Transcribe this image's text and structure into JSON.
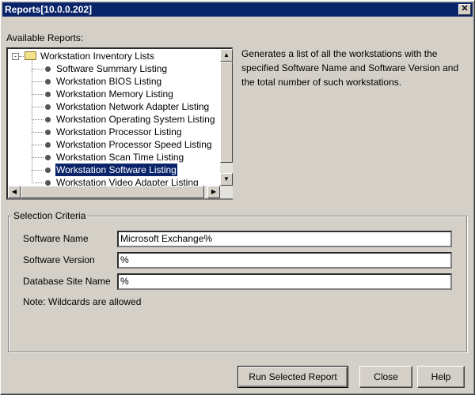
{
  "window": {
    "title": "Reports[10.0.0.202]",
    "close": "✕"
  },
  "available_reports_label": "Available Reports:",
  "tree": {
    "root": "Workstation Inventory Lists",
    "items": [
      "Software Summary Listing",
      "Workstation BIOS Listing",
      "Workstation Memory Listing",
      "Workstation Network Adapter Listing",
      "Workstation Operating System Listing",
      "Workstation Processor Listing",
      "Workstation Processor Speed Listing",
      "Workstation Scan Time Listing",
      "Workstation Software Listing",
      "Workstation Video Adapter Listing"
    ],
    "selected_index": 8
  },
  "description": "Generates a list of all the workstations with the specified Software Name and  Software Version and the total number of such workstations.",
  "criteria": {
    "title": "Selection Criteria",
    "fields": [
      {
        "label": "Software Name",
        "value": "Microsoft Exchange%"
      },
      {
        "label": "Software Version",
        "value": "%"
      },
      {
        "label": "Database Site Name",
        "value": "%"
      }
    ],
    "note": "Note: Wildcards are allowed"
  },
  "buttons": {
    "run": "Run Selected Report",
    "close": "Close",
    "help": "Help"
  }
}
